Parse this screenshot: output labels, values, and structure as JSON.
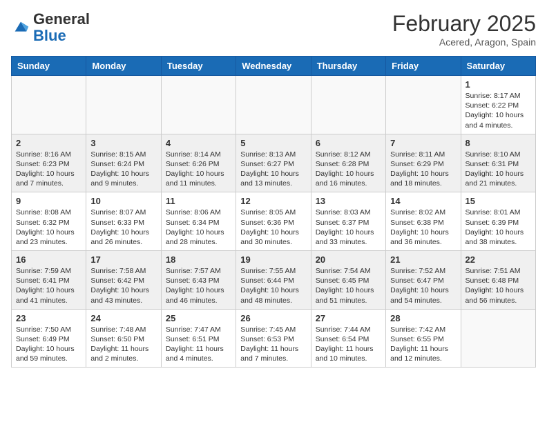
{
  "header": {
    "logo_general": "General",
    "logo_blue": "Blue",
    "month_year": "February 2025",
    "location": "Acered, Aragon, Spain"
  },
  "weekdays": [
    "Sunday",
    "Monday",
    "Tuesday",
    "Wednesday",
    "Thursday",
    "Friday",
    "Saturday"
  ],
  "weeks": [
    [
      {
        "day": "",
        "info": ""
      },
      {
        "day": "",
        "info": ""
      },
      {
        "day": "",
        "info": ""
      },
      {
        "day": "",
        "info": ""
      },
      {
        "day": "",
        "info": ""
      },
      {
        "day": "",
        "info": ""
      },
      {
        "day": "1",
        "info": "Sunrise: 8:17 AM\nSunset: 6:22 PM\nDaylight: 10 hours\nand 4 minutes."
      }
    ],
    [
      {
        "day": "2",
        "info": "Sunrise: 8:16 AM\nSunset: 6:23 PM\nDaylight: 10 hours\nand 7 minutes."
      },
      {
        "day": "3",
        "info": "Sunrise: 8:15 AM\nSunset: 6:24 PM\nDaylight: 10 hours\nand 9 minutes."
      },
      {
        "day": "4",
        "info": "Sunrise: 8:14 AM\nSunset: 6:26 PM\nDaylight: 10 hours\nand 11 minutes."
      },
      {
        "day": "5",
        "info": "Sunrise: 8:13 AM\nSunset: 6:27 PM\nDaylight: 10 hours\nand 13 minutes."
      },
      {
        "day": "6",
        "info": "Sunrise: 8:12 AM\nSunset: 6:28 PM\nDaylight: 10 hours\nand 16 minutes."
      },
      {
        "day": "7",
        "info": "Sunrise: 8:11 AM\nSunset: 6:29 PM\nDaylight: 10 hours\nand 18 minutes."
      },
      {
        "day": "8",
        "info": "Sunrise: 8:10 AM\nSunset: 6:31 PM\nDaylight: 10 hours\nand 21 minutes."
      }
    ],
    [
      {
        "day": "9",
        "info": "Sunrise: 8:08 AM\nSunset: 6:32 PM\nDaylight: 10 hours\nand 23 minutes."
      },
      {
        "day": "10",
        "info": "Sunrise: 8:07 AM\nSunset: 6:33 PM\nDaylight: 10 hours\nand 26 minutes."
      },
      {
        "day": "11",
        "info": "Sunrise: 8:06 AM\nSunset: 6:34 PM\nDaylight: 10 hours\nand 28 minutes."
      },
      {
        "day": "12",
        "info": "Sunrise: 8:05 AM\nSunset: 6:36 PM\nDaylight: 10 hours\nand 30 minutes."
      },
      {
        "day": "13",
        "info": "Sunrise: 8:03 AM\nSunset: 6:37 PM\nDaylight: 10 hours\nand 33 minutes."
      },
      {
        "day": "14",
        "info": "Sunrise: 8:02 AM\nSunset: 6:38 PM\nDaylight: 10 hours\nand 36 minutes."
      },
      {
        "day": "15",
        "info": "Sunrise: 8:01 AM\nSunset: 6:39 PM\nDaylight: 10 hours\nand 38 minutes."
      }
    ],
    [
      {
        "day": "16",
        "info": "Sunrise: 7:59 AM\nSunset: 6:41 PM\nDaylight: 10 hours\nand 41 minutes."
      },
      {
        "day": "17",
        "info": "Sunrise: 7:58 AM\nSunset: 6:42 PM\nDaylight: 10 hours\nand 43 minutes."
      },
      {
        "day": "18",
        "info": "Sunrise: 7:57 AM\nSunset: 6:43 PM\nDaylight: 10 hours\nand 46 minutes."
      },
      {
        "day": "19",
        "info": "Sunrise: 7:55 AM\nSunset: 6:44 PM\nDaylight: 10 hours\nand 48 minutes."
      },
      {
        "day": "20",
        "info": "Sunrise: 7:54 AM\nSunset: 6:45 PM\nDaylight: 10 hours\nand 51 minutes."
      },
      {
        "day": "21",
        "info": "Sunrise: 7:52 AM\nSunset: 6:47 PM\nDaylight: 10 hours\nand 54 minutes."
      },
      {
        "day": "22",
        "info": "Sunrise: 7:51 AM\nSunset: 6:48 PM\nDaylight: 10 hours\nand 56 minutes."
      }
    ],
    [
      {
        "day": "23",
        "info": "Sunrise: 7:50 AM\nSunset: 6:49 PM\nDaylight: 10 hours\nand 59 minutes."
      },
      {
        "day": "24",
        "info": "Sunrise: 7:48 AM\nSunset: 6:50 PM\nDaylight: 11 hours\nand 2 minutes."
      },
      {
        "day": "25",
        "info": "Sunrise: 7:47 AM\nSunset: 6:51 PM\nDaylight: 11 hours\nand 4 minutes."
      },
      {
        "day": "26",
        "info": "Sunrise: 7:45 AM\nSunset: 6:53 PM\nDaylight: 11 hours\nand 7 minutes."
      },
      {
        "day": "27",
        "info": "Sunrise: 7:44 AM\nSunset: 6:54 PM\nDaylight: 11 hours\nand 10 minutes."
      },
      {
        "day": "28",
        "info": "Sunrise: 7:42 AM\nSunset: 6:55 PM\nDaylight: 11 hours\nand 12 minutes."
      },
      {
        "day": "",
        "info": ""
      }
    ]
  ]
}
